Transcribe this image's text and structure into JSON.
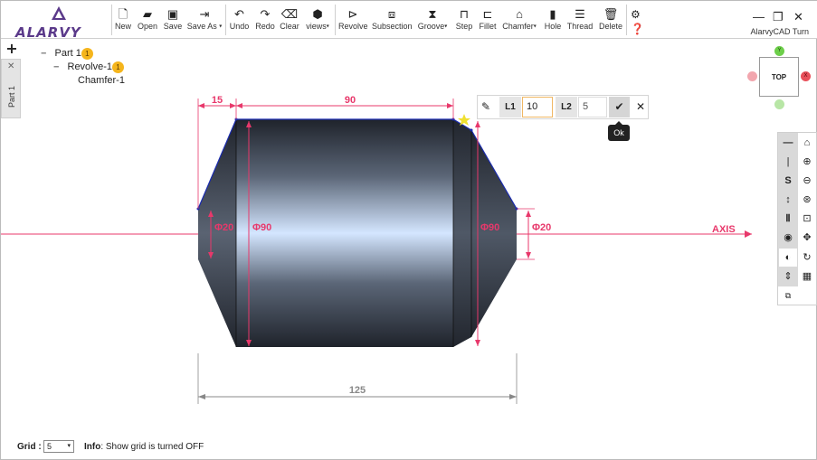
{
  "app": {
    "logo_text": "ALARVY",
    "name": "AlarvyCAD Turn"
  },
  "toolbar": {
    "buttons": [
      {
        "label": "New",
        "icon": "file-icon"
      },
      {
        "label": "Open",
        "icon": "folder-open-icon"
      },
      {
        "label": "Save",
        "icon": "save-icon"
      },
      {
        "label": "Save As",
        "icon": "export-icon"
      },
      {
        "label": "Undo",
        "icon": "undo-icon"
      },
      {
        "label": "Redo",
        "icon": "redo-icon"
      },
      {
        "label": "Clear",
        "icon": "eraser-icon"
      },
      {
        "label": "views",
        "icon": "cube-icon"
      },
      {
        "label": "Revolve",
        "icon": "revolve-icon"
      },
      {
        "label": "Subsection",
        "icon": "subsection-icon"
      },
      {
        "label": "Groove",
        "icon": "groove-icon"
      },
      {
        "label": "Step",
        "icon": "step-icon"
      },
      {
        "label": "Fillet",
        "icon": "fillet-icon"
      },
      {
        "label": "Chamfer",
        "icon": "chamfer-icon"
      },
      {
        "label": "Hole",
        "icon": "hole-icon"
      },
      {
        "label": "Thread",
        "icon": "thread-icon"
      },
      {
        "label": "Delete",
        "icon": "trash-icon"
      }
    ],
    "caret": "▾"
  },
  "left_panel": {
    "add_symbol": "+",
    "close_symbol": "✕",
    "tab_label": "Part 1"
  },
  "tree": {
    "items": [
      {
        "label": "Part 1",
        "badge": "1",
        "expander": "−"
      },
      {
        "label": "Revolve-1",
        "badge": "1",
        "expander": "−"
      },
      {
        "label": "Chamfer-1"
      }
    ]
  },
  "popup": {
    "l1_label": "L1",
    "l1_value": "10",
    "l2_label": "L2",
    "l2_value": "5",
    "ok_tooltip": "Ok"
  },
  "view_cube": {
    "face": "TOP",
    "y_label": "Y",
    "x_label": "X"
  },
  "drawing": {
    "dims": {
      "left_step": "15",
      "body_length": "90",
      "total_length": "125",
      "dia_left_small": "Φ20",
      "dia_left_big": "Φ90",
      "dia_right_big": "Φ90",
      "dia_right_small": "Φ20"
    },
    "axis_label": "AXIS"
  },
  "status": {
    "grid_label": "Grid :",
    "grid_value": "5",
    "info_label": "Info",
    "info_text": ": Show grid is turned OFF"
  },
  "colors": {
    "dimension": "#e8386b",
    "edge": "#1a2bb0",
    "badge": "#f5b51c",
    "logo": "#5b3a8a"
  }
}
